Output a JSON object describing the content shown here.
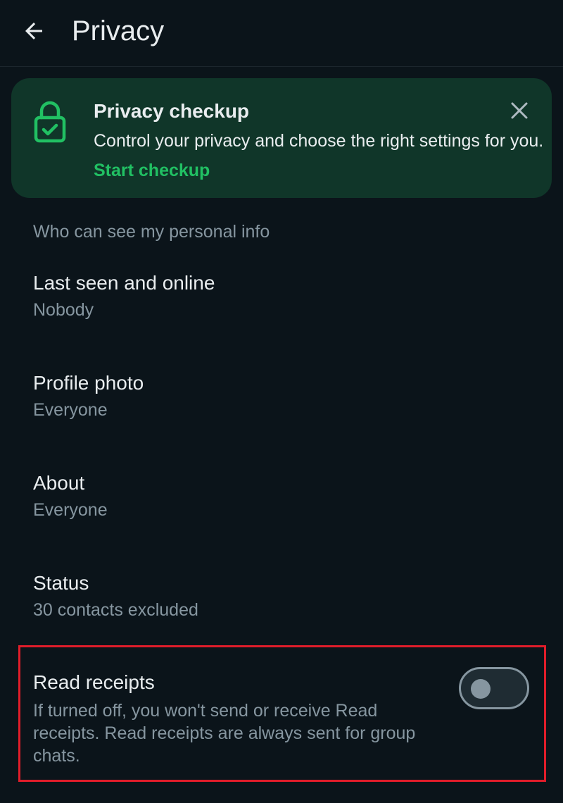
{
  "header": {
    "title": "Privacy",
    "back_icon": "arrow-left-icon"
  },
  "checkup": {
    "title": "Privacy checkup",
    "body": "Control your privacy and choose the right settings for you.",
    "link": "Start checkup",
    "icon": "lock-check-icon",
    "close_icon": "close-icon",
    "background_color": "#103629",
    "accent_color": "#21c063"
  },
  "section": {
    "header": "Who can see my personal info",
    "items": [
      {
        "label": "Last seen and online",
        "value": "Nobody"
      },
      {
        "label": "Profile photo",
        "value": "Everyone"
      },
      {
        "label": "About",
        "value": "Everyone"
      },
      {
        "label": "Status",
        "value": "30 contacts excluded"
      }
    ]
  },
  "read_receipts": {
    "label": "Read receipts",
    "description": "If turned off, you won't send or receive Read receipts. Read receipts are always sent for group chats.",
    "enabled": false,
    "highlight_color": "#e11d2a"
  }
}
